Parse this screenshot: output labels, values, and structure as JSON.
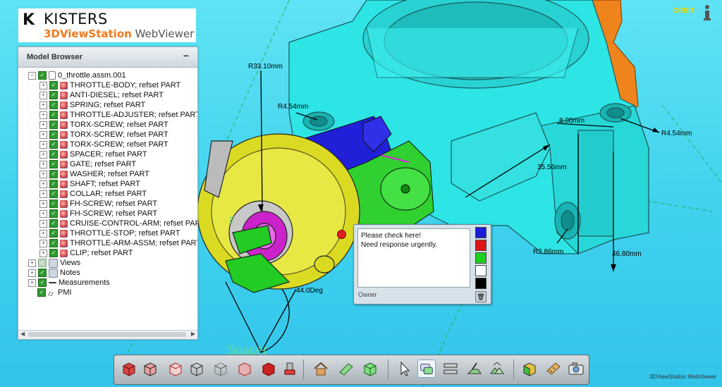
{
  "logo": {
    "company": "KISTERS",
    "product_part1": "3DViewStation",
    "product_part2": " WebViewer"
  },
  "model_browser": {
    "title": "Model Browser",
    "collapse_label": "−",
    "root": "0_throttle.assm.001",
    "parts": [
      "THROTTLE-BODY; refset PART",
      "ANTI-DIESEL; refset PART",
      "SPRING; refset PART",
      "THROTTLE-ADJUSTER; refset PART",
      "TORX-SCREW; refset PART",
      "TORX-SCREW; refset PART",
      "TORX-SCREW; refset PART",
      "SPACER; refset PART",
      "GATE; refset PART",
      "WASHER; refset PART",
      "SHAFT; refset PART",
      "COLLAR; refset PART",
      "FH-SCREW; refset PART",
      "FH-SCREW; refset PART",
      "CRUISE-CONTROL-ARM; refset PAR",
      "THROTTLE-STOP; refset PART",
      "THROTTLE-ARM-ASSM; refset PART",
      "CLIP; refset PART"
    ],
    "sections": [
      "Views",
      "Notes",
      "Measurements",
      "PMI"
    ]
  },
  "viewport": {
    "mode": "ORBIT",
    "dimensions": {
      "r1": "R33.10mm",
      "r2": "R4.54mm",
      "r3": "R4.54mm",
      "d1": "8.00mm",
      "d2": "35.56mm",
      "r4": "R2.86mm",
      "d3": "46.80mm",
      "angle": "44.0Deg"
    },
    "ghost_label": "Spacer",
    "ghost_label_small": "E"
  },
  "note": {
    "text_line1": "Please check here!",
    "text_line2": "Need response urgently.",
    "owner_label": "Owner",
    "colors": [
      "#1a1ad8",
      "#e01616",
      "#1ed01e",
      "#ffffff",
      "#000000"
    ]
  },
  "footer": {
    "label": "3DViewStation WebViewer"
  },
  "toolbar": {
    "buttons": [
      "shaded-view-icon",
      "shaded-edges-view-icon",
      "hidden-line-view-icon",
      "wireframe-view-icon",
      "transparent-view-icon",
      "outline-view-icon",
      "solid-red-view-icon",
      "section-view-icon",
      "home-icon",
      "fit-view-icon",
      "iso-view-icon",
      "select-cursor-icon",
      "notes-icon",
      "measure-icon",
      "markup-icon",
      "explode-icon",
      "part-colors-icon",
      "tape-measure-icon",
      "screenshot-icon"
    ]
  }
}
